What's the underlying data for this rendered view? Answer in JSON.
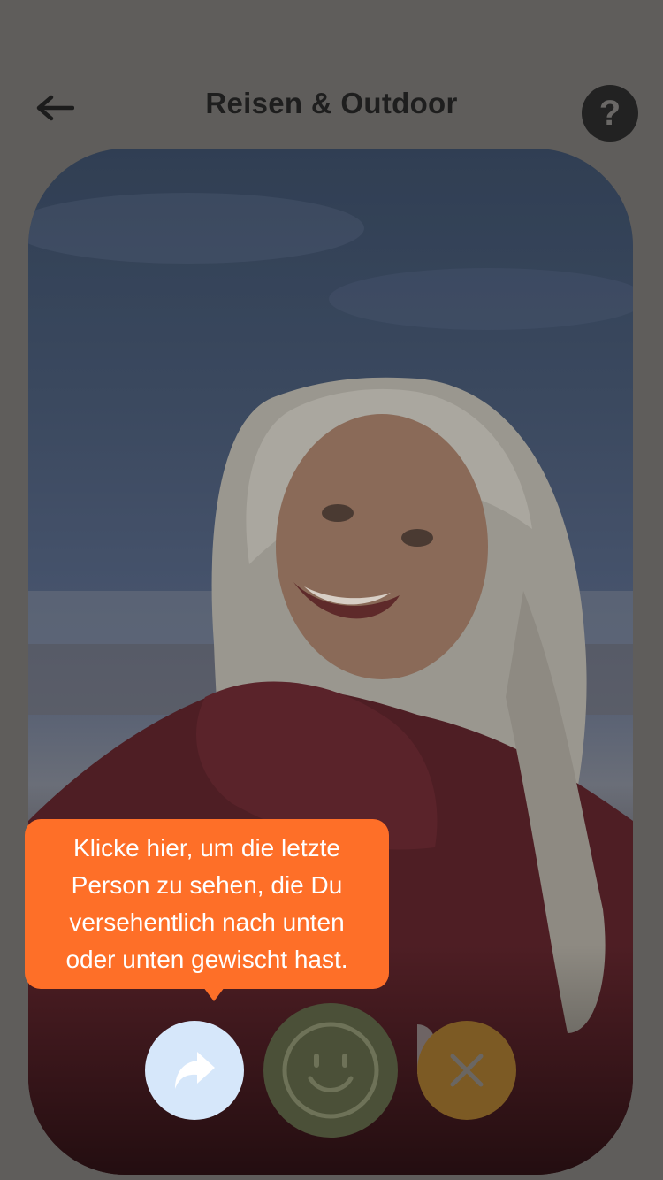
{
  "header": {
    "title": "Reisen & Outdoor",
    "back_icon": "arrow-left-icon",
    "help_label": "?"
  },
  "card": {
    "photo_subject": "woman-with-long-white-hair-red-knit-scarf-beach"
  },
  "tooltip": {
    "lines": [
      "Klicke hier, um die letzte",
      "Person zu sehen, die Du",
      "versehentlich nach unten",
      "oder unten gewischt hast."
    ],
    "color": "#fe6f28"
  },
  "actions": {
    "undo_icon": "share-forward-arrow-icon",
    "like_icon": "smiley-face-icon",
    "nope_icon": "close-x-icon",
    "undo_color": "#d6e7fa",
    "like_color": "#4b5038",
    "nope_color": "#7c5a24"
  },
  "colors": {
    "overlay": "#5f5d5b",
    "title_text": "#1e1e1e",
    "help_button": "#222222"
  }
}
